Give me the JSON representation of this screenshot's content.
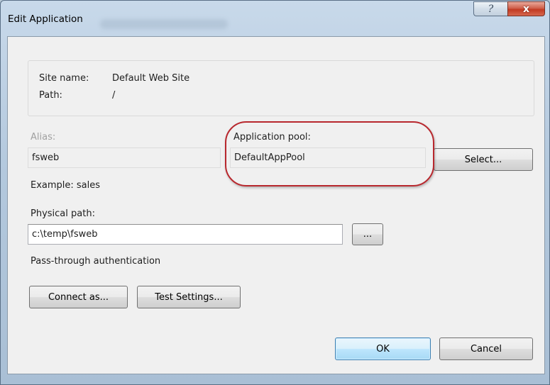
{
  "window": {
    "title": "Edit Application",
    "help_glyph": "?",
    "close_glyph": "x"
  },
  "info": {
    "site_name_label": "Site name:",
    "site_name_value": "Default Web Site",
    "path_label": "Path:",
    "path_value": "/"
  },
  "alias": {
    "label": "Alias:",
    "value": "fsweb",
    "example": "Example: sales"
  },
  "app_pool": {
    "label": "Application pool:",
    "value": "DefaultAppPool",
    "select_label": "Select..."
  },
  "physical_path": {
    "label": "Physical path:",
    "value": "c:\\temp\\fsweb",
    "browse_label": "..."
  },
  "auth": {
    "label": "Pass-through authentication",
    "connect_as_label": "Connect as...",
    "test_settings_label": "Test Settings..."
  },
  "footer": {
    "ok_label": "OK",
    "cancel_label": "Cancel"
  },
  "colors": {
    "highlight": "#b8282e",
    "close_button": "#c23a22",
    "dialog_background": "#f0f0f0"
  }
}
